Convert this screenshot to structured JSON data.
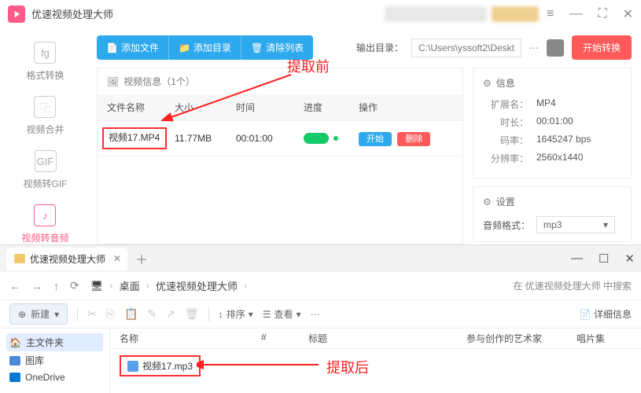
{
  "app": {
    "title": "优速视频处理大师",
    "toolbar": {
      "add_file": "添加文件",
      "add_folder": "添加目录",
      "clear_list": "清除列表"
    },
    "output_label": "输出目录：",
    "output_path": "C:\\Users\\yssoft2\\Deskt",
    "start_convert": "开始转换"
  },
  "sidebar": {
    "items": [
      {
        "label": "格式转换",
        "icon": "fg"
      },
      {
        "label": "视频合并",
        "icon": "⿻"
      },
      {
        "label": "视频转GIF",
        "icon": "GIF"
      },
      {
        "label": "视频转音频",
        "icon": "♪"
      }
    ]
  },
  "table": {
    "header_title": "视频信息（1个）",
    "cols": {
      "name": "文件名称",
      "size": "大小",
      "time": "时间",
      "progress": "进度",
      "action": "操作"
    },
    "row": {
      "name": "视频17.MP4",
      "size": "11.77MB",
      "time": "00:01:00",
      "start": "开始",
      "del": "删除"
    }
  },
  "info": {
    "title": "信息",
    "ext_k": "扩展名：",
    "ext_v": "MP4",
    "dur_k": "时长：",
    "dur_v": "00:01:00",
    "rate_k": "码率：",
    "rate_v": "1645247 bps",
    "res_k": "分辨率：",
    "res_v": "2560x1440"
  },
  "settings": {
    "title": "设置",
    "audio_fmt_k": "音频格式：",
    "audio_fmt_v": "mp3"
  },
  "annotations": {
    "before": "提取前",
    "after": "提取后"
  },
  "explorer": {
    "tab_title": "优速视频处理大师",
    "breadcrumb": [
      "桌面",
      "优速视频处理大师"
    ],
    "search_hint": "在 优速视频处理大师 中搜索",
    "new_btn": "新建",
    "sort": "排序",
    "view": "查看",
    "details": "详细信息",
    "side": {
      "main": "主文件夹",
      "gallery": "图库",
      "onedrive": "OneDrive"
    },
    "cols": {
      "name": "名称",
      "num": "#",
      "title": "标题",
      "artist": "参与创作的艺术家",
      "album": "唱片集"
    },
    "file": "视频17.mp3"
  }
}
